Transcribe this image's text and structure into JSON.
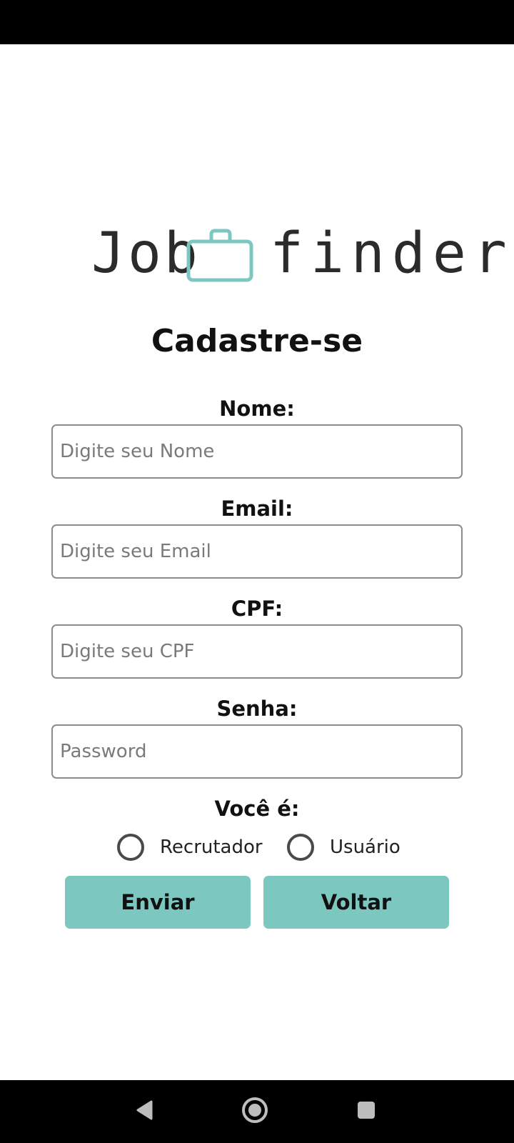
{
  "app": {
    "logo_left": "Job",
    "logo_right": "finder",
    "logo_icon": "briefcase-icon",
    "accent_color": "#7cc7c0"
  },
  "page": {
    "title": "Cadastre-se"
  },
  "form": {
    "nome": {
      "label": "Nome:",
      "placeholder": "Digite seu Nome",
      "value": ""
    },
    "email": {
      "label": "Email:",
      "placeholder": "Digite seu Email",
      "value": ""
    },
    "cpf": {
      "label": "CPF:",
      "placeholder": "Digite seu CPF",
      "value": ""
    },
    "senha": {
      "label": "Senha:",
      "placeholder": "Password",
      "value": ""
    },
    "tipo": {
      "label": "Você é:",
      "options": [
        {
          "label": "Recrutador",
          "selected": false
        },
        {
          "label": "Usuário",
          "selected": false
        }
      ]
    }
  },
  "actions": {
    "submit_label": "Enviar",
    "back_label": "Voltar"
  },
  "system_nav": {
    "back_icon": "back-triangle-icon",
    "home_icon": "home-circle-icon",
    "recents_icon": "recents-square-icon"
  }
}
